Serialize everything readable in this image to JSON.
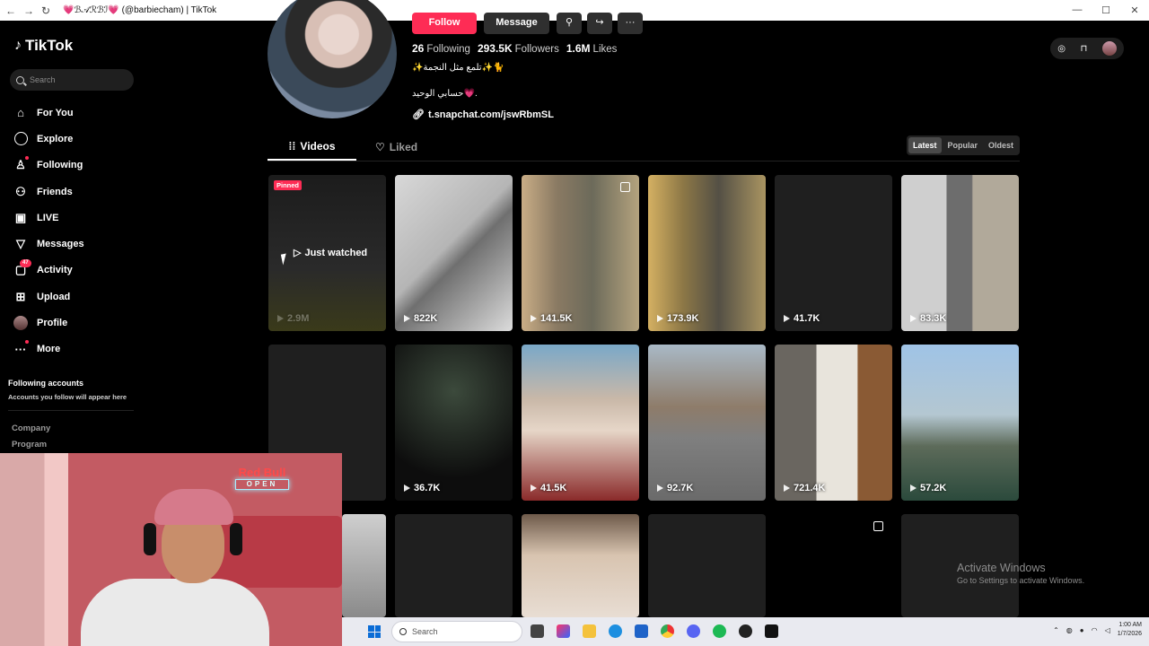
{
  "window": {
    "tab_title": "💗ℬ𝒜ℛℬℐ💗 (@barbiecham) | TikTok",
    "nav_back": "←",
    "nav_forward": "→",
    "nav_refresh": "↻",
    "minimize": "—",
    "maximize": "☐",
    "close": "✕"
  },
  "sidebar": {
    "logo_text": "TikTok",
    "search_placeholder": "Search",
    "items": [
      {
        "label": "For You",
        "icon": "home-icon"
      },
      {
        "label": "Explore",
        "icon": "compass-icon"
      },
      {
        "label": "Following",
        "icon": "following-icon"
      },
      {
        "label": "Friends",
        "icon": "friends-icon"
      },
      {
        "label": "LIVE",
        "icon": "live-icon"
      },
      {
        "label": "Messages",
        "icon": "messages-icon"
      },
      {
        "label": "Activity",
        "icon": "activity-icon",
        "badge": "47"
      },
      {
        "label": "Upload",
        "icon": "upload-icon"
      },
      {
        "label": "Profile",
        "icon": "avatar"
      },
      {
        "label": "More",
        "icon": "more-icon"
      }
    ],
    "following_title": "Following accounts",
    "following_sub": "Accounts you follow will appear here",
    "company": "Company",
    "program": "Program"
  },
  "profile": {
    "follow_label": "Follow",
    "message_label": "Message",
    "stats": [
      {
        "value": "26",
        "label": "Following"
      },
      {
        "value": "293.5K",
        "label": "Followers"
      },
      {
        "value": "1.6M",
        "label": "Likes"
      }
    ],
    "bio_line1": "✨تلمع مثل النجمة✨🐈",
    "bio_line2": "حسابي الوحيد💗.",
    "link": "t.snapchat.com/jswRbmSL"
  },
  "tabs": {
    "videos": "Videos",
    "liked": "Liked"
  },
  "sort": {
    "options": [
      "Latest",
      "Popular",
      "Oldest"
    ],
    "selected": "Latest"
  },
  "videos": {
    "row1": [
      {
        "views": "2.9M",
        "pinned": "Pinned",
        "overlay": "Just watched"
      },
      {
        "views": "822K"
      },
      {
        "views": "141.5K"
      },
      {
        "views": "173.9K"
      },
      {
        "views": "41.7K"
      },
      {
        "views": "83.3K"
      }
    ],
    "row2": [
      {
        "views": ""
      },
      {
        "views": "36.7K"
      },
      {
        "views": "41.5K"
      },
      {
        "views": "92.7K"
      },
      {
        "views": "721.4K"
      },
      {
        "views": "57.2K"
      }
    ]
  },
  "overlay_cam": {
    "logo_top": "Red Bull",
    "logo_bottom": "OPEN"
  },
  "taskbar": {
    "search_placeholder": "Search",
    "time": "1:00 AM",
    "date": "1/7/2026"
  },
  "watermark": {
    "line1": "Activate Windows",
    "line2": "Go to Settings to activate Windows."
  },
  "colors": {
    "accent": "#fe2c55",
    "background": "#000000"
  }
}
